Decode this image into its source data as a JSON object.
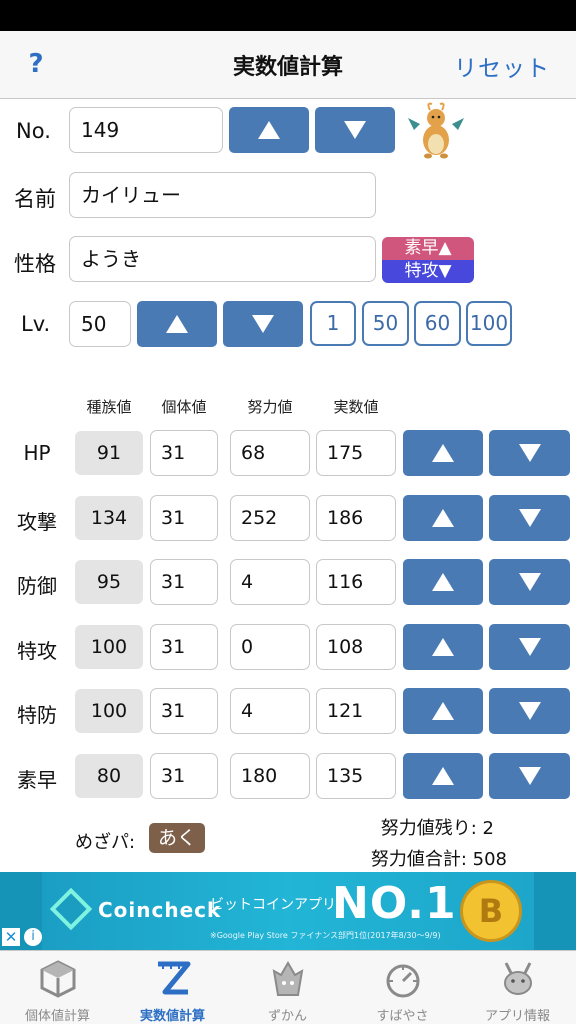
{
  "nav": {
    "help": "?",
    "title": "実数値計算",
    "reset": "リセット"
  },
  "form": {
    "no_label": "No.",
    "no_value": "149",
    "name_label": "名前",
    "name_value": "カイリュー",
    "nature_label": "性格",
    "nature_value": "ようき",
    "nature_up": "素早▲",
    "nature_down": "特攻▼",
    "lv_label": "Lv.",
    "lv_value": "50",
    "lv_quick": [
      "1",
      "50",
      "60",
      "100"
    ]
  },
  "columns": {
    "base": "種族値",
    "iv": "個体値",
    "ev": "努力値",
    "actual": "実数値"
  },
  "stats": [
    {
      "name": "HP",
      "base": "91",
      "iv": "31",
      "ev": "68",
      "actual": "175"
    },
    {
      "name": "攻撃",
      "base": "134",
      "iv": "31",
      "ev": "252",
      "actual": "186"
    },
    {
      "name": "防御",
      "base": "95",
      "iv": "31",
      "ev": "4",
      "actual": "116"
    },
    {
      "name": "特攻",
      "base": "100",
      "iv": "31",
      "ev": "0",
      "actual": "108"
    },
    {
      "name": "特防",
      "base": "100",
      "iv": "31",
      "ev": "4",
      "actual": "121"
    },
    {
      "name": "素早",
      "base": "80",
      "iv": "31",
      "ev": "180",
      "actual": "135"
    }
  ],
  "summary": {
    "mezapa_label": "めざパ:",
    "mezapa_type": "あく",
    "ev_remaining": "努力値残り: 2",
    "ev_total": "努力値合計: 508"
  },
  "ad": {
    "brand": "Coincheck",
    "tagline": "ビットコインアプリ",
    "headline": "NO.1",
    "fineprint": "※Google Play Store ファイナンス部門1位(2017年8/30〜9/9)",
    "coin_symbol": "B"
  },
  "tabs": [
    {
      "label": "個体値計算",
      "icon": "cube-icon",
      "active": false
    },
    {
      "label": "実数値計算",
      "icon": "ruler-z-icon",
      "active": true
    },
    {
      "label": "ずかん",
      "icon": "pokedex-icon",
      "active": false
    },
    {
      "label": "すばやさ",
      "icon": "speedometer-icon",
      "active": false
    },
    {
      "label": "アプリ情報",
      "icon": "pikachu-icon",
      "active": false
    }
  ],
  "colors": {
    "accent": "#2d6fc4",
    "button": "#4a7ab3",
    "nature_up": "#d1567d",
    "nature_down": "#4848dc",
    "mezapa_badge": "#7d5f4a"
  }
}
